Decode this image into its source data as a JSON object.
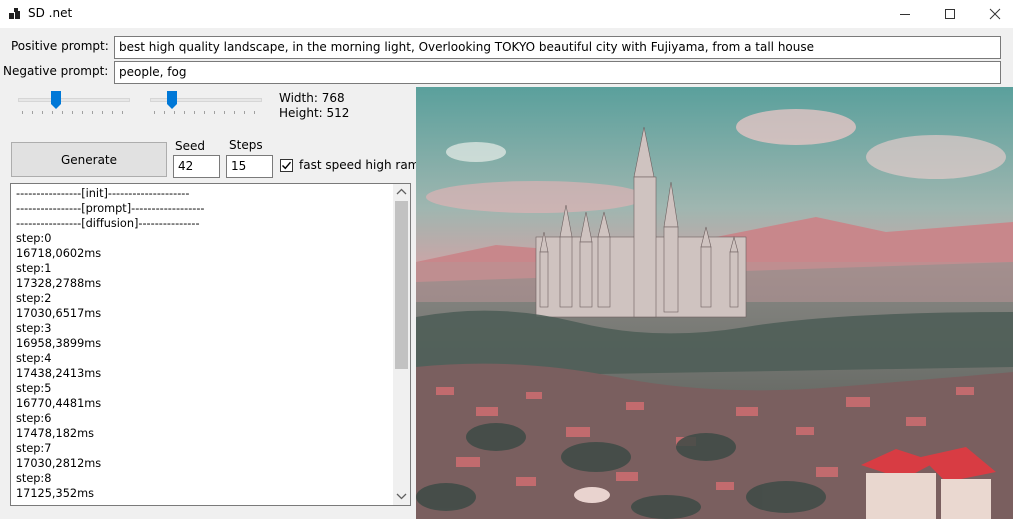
{
  "window": {
    "title": "SD .net"
  },
  "prompts": {
    "positive_label": "Positive prompt:",
    "positive_value": "best high quality landscape, in the morning light, Overlooking TOKYO beautiful city with Fujiyama,  from a tall house",
    "negative_label": "Negative prompt:",
    "negative_value": "people, fog"
  },
  "size": {
    "width_text": "Width: 768",
    "height_text": "Height: 512",
    "width_slider_fraction": 0.32,
    "height_slider_fraction": 0.17
  },
  "controls": {
    "generate_label": "Generate",
    "seed_label": "Seed",
    "seed_value": "42",
    "steps_label": "Steps",
    "steps_value": "15",
    "fast_label": "fast speed high ram",
    "fast_checked": true
  },
  "log": [
    "----------------[init]--------------------",
    "----------------[prompt]------------------",
    "----------------[diffusion]---------------",
    "step:0",
    "16718,0602ms",
    "step:1",
    "17328,2788ms",
    "step:2",
    "17030,6517ms",
    "step:3",
    "16958,3899ms",
    "step:4",
    "17438,2413ms",
    "step:5",
    "16770,4481ms",
    "step:6",
    "17478,182ms",
    "step:7",
    "17030,2812ms",
    "step:8",
    "17125,352ms"
  ],
  "icons": {
    "app": "app-icon",
    "minimize": "minimize-icon",
    "maximize": "maximize-icon",
    "close": "close-icon",
    "scroll_up": "scroll-up-icon",
    "scroll_down": "scroll-down-icon",
    "check": "check-icon"
  },
  "colors": {
    "accent": "#0078d7",
    "window_bg": "#f0f0f0"
  }
}
